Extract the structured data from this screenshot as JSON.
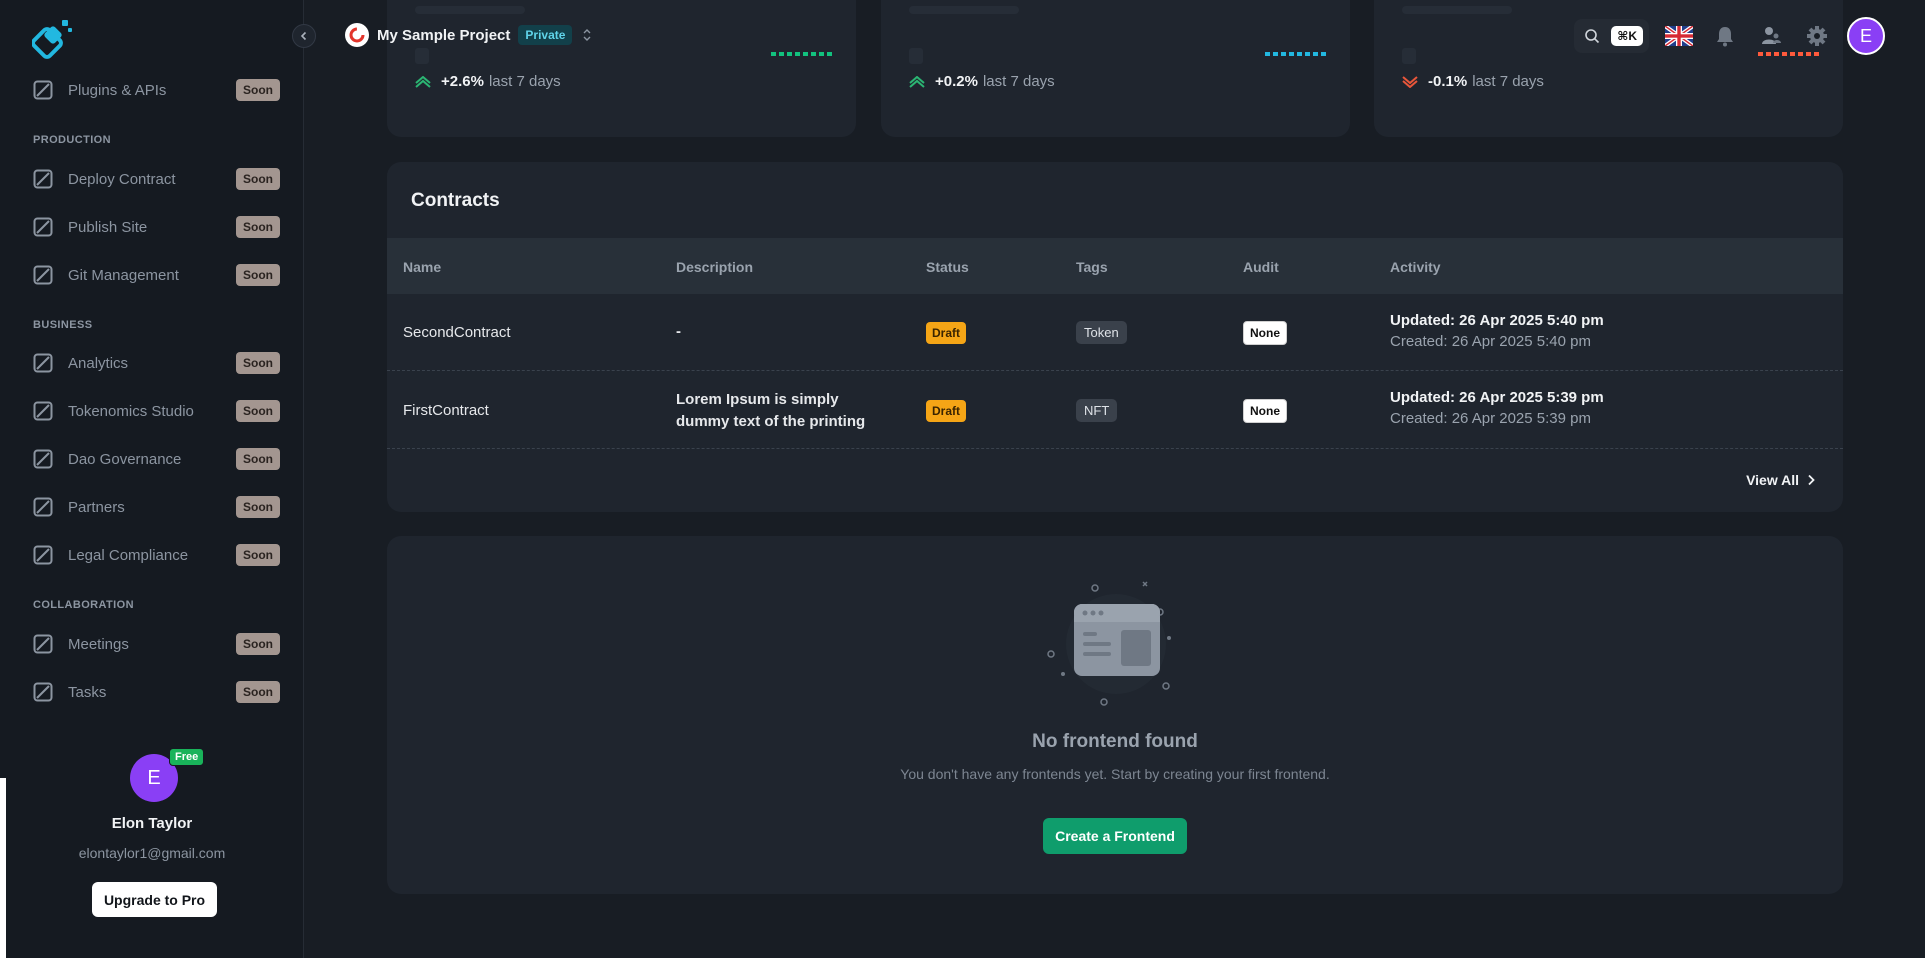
{
  "colors": {
    "accent_green": "#0f9d6c",
    "draft": "#f5a516",
    "soon": "#a39690",
    "avatar": "#8a3ff5",
    "trend_up": "#2bb673",
    "trend_down": "#e8563a",
    "bars_green": "#12c27e",
    "bars_cyan": "#22b8e0",
    "bars_red": "#ff5a3c"
  },
  "sidebar": {
    "items_top": [
      {
        "label": "Plugins & APIs",
        "badge": "Soon"
      }
    ],
    "sections": [
      {
        "title": "PRODUCTION",
        "items": [
          {
            "label": "Deploy Contract",
            "badge": "Soon"
          },
          {
            "label": "Publish Site",
            "badge": "Soon"
          },
          {
            "label": "Git Management",
            "badge": "Soon"
          }
        ]
      },
      {
        "title": "BUSINESS",
        "items": [
          {
            "label": "Analytics",
            "badge": "Soon"
          },
          {
            "label": "Tokenomics Studio",
            "badge": "Soon"
          },
          {
            "label": "Dao Governance",
            "badge": "Soon"
          },
          {
            "label": "Partners",
            "badge": "Soon"
          },
          {
            "label": "Legal Compliance",
            "badge": "Soon"
          }
        ]
      },
      {
        "title": "COLLABORATION",
        "items": [
          {
            "label": "Meetings",
            "badge": "Soon"
          },
          {
            "label": "Tasks",
            "badge": "Soon"
          }
        ]
      }
    ],
    "profile": {
      "initial": "E",
      "plan_badge": "Free",
      "name": "Elon Taylor",
      "email": "elontaylor1@gmail.com",
      "upgrade_label": "Upgrade to Pro"
    }
  },
  "topbar": {
    "project_name": "My Sample Project",
    "visibility": "Private",
    "search_shortcut": "⌘K",
    "avatar_initial": "E",
    "icons": [
      "search-icon",
      "uk-flag-icon",
      "bell-icon",
      "users-icon",
      "gear-icon"
    ]
  },
  "stats": [
    {
      "trend": "+2.6%",
      "caption": "last 7 days",
      "direction": "up"
    },
    {
      "trend": "+0.2%",
      "caption": "last 7 days",
      "direction": "up"
    },
    {
      "trend": "-0.1%",
      "caption": "last 7 days",
      "direction": "down"
    }
  ],
  "contracts": {
    "title": "Contracts",
    "columns": [
      "Name",
      "Description",
      "Status",
      "Tags",
      "Audit",
      "Activity"
    ],
    "rows": [
      {
        "name": "SecondContract",
        "description": "-",
        "status": "Draft",
        "tag": "Token",
        "audit": "None",
        "updated": "Updated: 26 Apr 2025 5:40 pm",
        "created": "Created: 26 Apr 2025 5:40 pm"
      },
      {
        "name": "FirstContract",
        "description": "Lorem Ipsum is simply dummy text of the printing",
        "status": "Draft",
        "tag": "NFT",
        "audit": "None",
        "updated": "Updated: 26 Apr 2025 5:39 pm",
        "created": "Created: 26 Apr 2025 5:39 pm"
      }
    ],
    "view_all_label": "View All"
  },
  "frontend": {
    "empty_title": "No frontend found",
    "empty_text": "You don't have any frontends yet. Start by creating your first frontend.",
    "create_label": "Create a Frontend"
  }
}
